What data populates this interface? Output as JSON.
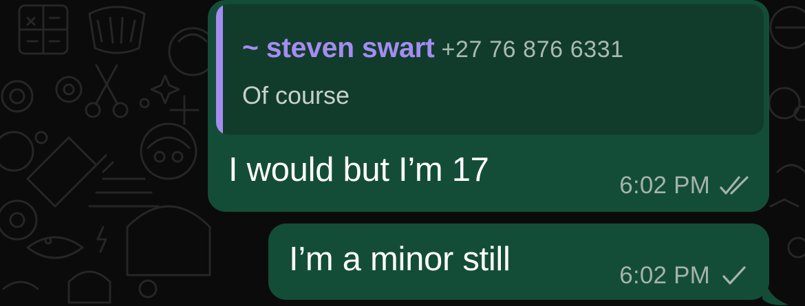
{
  "colors": {
    "background": "#0b0b0b",
    "bubble_outgoing": "#144d37",
    "quote_background": "#113c2b",
    "quote_accent": "#a58cf2",
    "meta_text": "#a4b4ad",
    "message_text": "#ffffff"
  },
  "messages": [
    {
      "quoted": {
        "sender_name": "~ steven swart",
        "sender_phone": "+27 76 876 6331",
        "text": "Of course"
      },
      "text": "I would but I’m 17",
      "time": "6:02 PM",
      "status_icon": "double-check-icon"
    },
    {
      "text": "I’m a minor still",
      "time": "6:02 PM",
      "status_icon": "single-check-icon"
    }
  ]
}
